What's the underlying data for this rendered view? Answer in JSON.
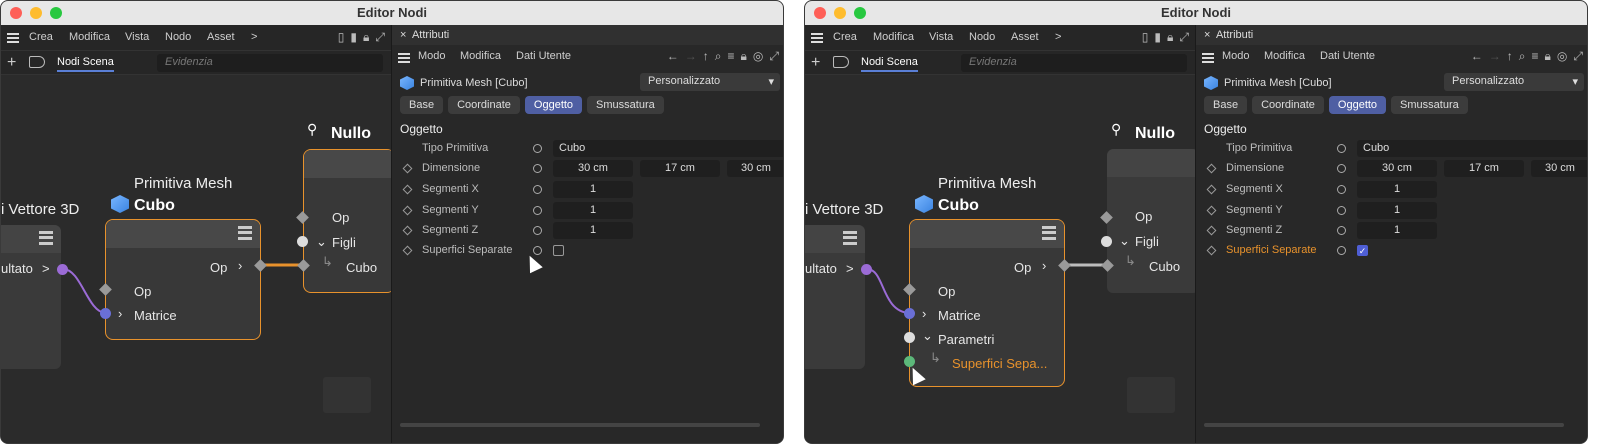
{
  "app_title": "Editor Nodi",
  "menu": {
    "items": [
      "Crea",
      "Modifica",
      "Vista",
      "Nodo",
      "Asset"
    ],
    "more": ">"
  },
  "scene_tab": "Nodi Scena",
  "search_placeholder": "Evidenzia",
  "nodes": {
    "vettore": {
      "title": "i Vettore 3D",
      "port": "ultato",
      "chev": ">"
    },
    "mesh": {
      "title": "Primitiva Mesh",
      "name": "Cubo",
      "out": "Op",
      "in_op": "Op",
      "in_matrice": "Matrice",
      "parametri": "Parametri",
      "superfici": "Superfici Sepa..."
    },
    "nullo": {
      "title": "Nullo",
      "op": "Op",
      "figli": "Figli",
      "cubo": "Cubo"
    }
  },
  "attributes": {
    "title": "Attributi",
    "menu": [
      "Modo",
      "Modifica",
      "Dati Utente"
    ],
    "object_label": "Primitiva Mesh [Cubo]",
    "preset": "Personalizzato",
    "tabs": [
      "Base",
      "Coordinate",
      "Oggetto",
      "Smussatura"
    ],
    "section": "Oggetto",
    "rows": [
      {
        "label": "Tipo Primitiva",
        "value": "Cubo"
      },
      {
        "label": "Dimensione",
        "v1": "30 cm",
        "v2": "17 cm",
        "v3": "30 cm"
      },
      {
        "label": "Segmenti X",
        "value": "1"
      },
      {
        "label": "Segmenti Y",
        "value": "1"
      },
      {
        "label": "Segmenti Z",
        "value": "1"
      },
      {
        "label": "Superfici Separate"
      }
    ]
  },
  "colors": {
    "accent": "#e8922c",
    "tab_active": "#4f5fa3",
    "highlight": "#e8922c"
  }
}
